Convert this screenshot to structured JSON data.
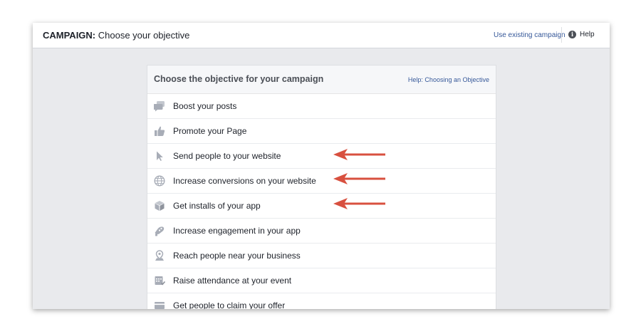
{
  "header": {
    "title_bold": "CAMPAIGN:",
    "title_rest": " Choose your objective",
    "use_existing": "Use existing campaign",
    "help": "Help"
  },
  "panel": {
    "title": "Choose the objective for your campaign",
    "help_link": "Help: Choosing an Objective",
    "objectives": [
      {
        "label": "Boost your posts",
        "icon": "speech-bubbles-icon"
      },
      {
        "label": "Promote your Page",
        "icon": "thumbs-up-icon"
      },
      {
        "label": "Send people to your website",
        "icon": "cursor-icon"
      },
      {
        "label": "Increase conversions on your website",
        "icon": "globe-icon"
      },
      {
        "label": "Get installs of your app",
        "icon": "box-icon"
      },
      {
        "label": "Increase engagement in your app",
        "icon": "game-controller-icon"
      },
      {
        "label": "Reach people near your business",
        "icon": "location-pin-icon"
      },
      {
        "label": "Raise attendance at your event",
        "icon": "calendar-icon"
      },
      {
        "label": "Get people to claim your offer",
        "icon": "offer-card-icon"
      }
    ]
  },
  "colors": {
    "icon": "#a8adb7",
    "link": "#365899",
    "arrow": "#d8503f",
    "background": "#e9eaed"
  }
}
